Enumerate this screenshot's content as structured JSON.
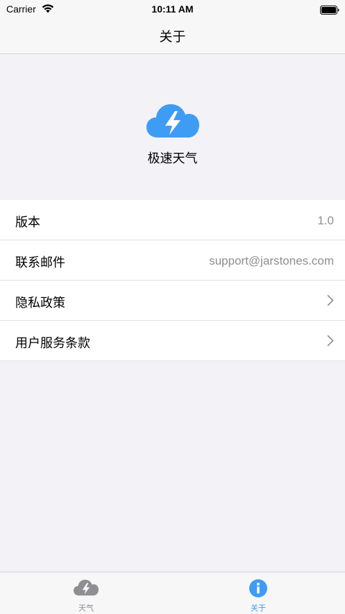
{
  "status_bar": {
    "carrier": "Carrier",
    "time": "10:11 AM"
  },
  "nav": {
    "title": "关于"
  },
  "app": {
    "name": "极速天气",
    "logo_icon": "cloud-lightning-icon"
  },
  "rows": [
    {
      "label": "版本",
      "value": "1.0"
    },
    {
      "label": "联系邮件",
      "value": "support@jarstones.com"
    },
    {
      "label": "隐私政策",
      "accessory": "chevron-right-icon"
    },
    {
      "label": "用户服务条款",
      "accessory": "chevron-right-icon"
    }
  ],
  "tabs": [
    {
      "label": "天气",
      "icon": "cloud-lightning-icon",
      "active": false
    },
    {
      "label": "关于",
      "icon": "info-icon",
      "active": true
    }
  ],
  "colors": {
    "accent": "#3f9cf4",
    "inactive": "#8e8e93",
    "background": "#f2f2f7",
    "secondary_text": "#8e8e93"
  }
}
